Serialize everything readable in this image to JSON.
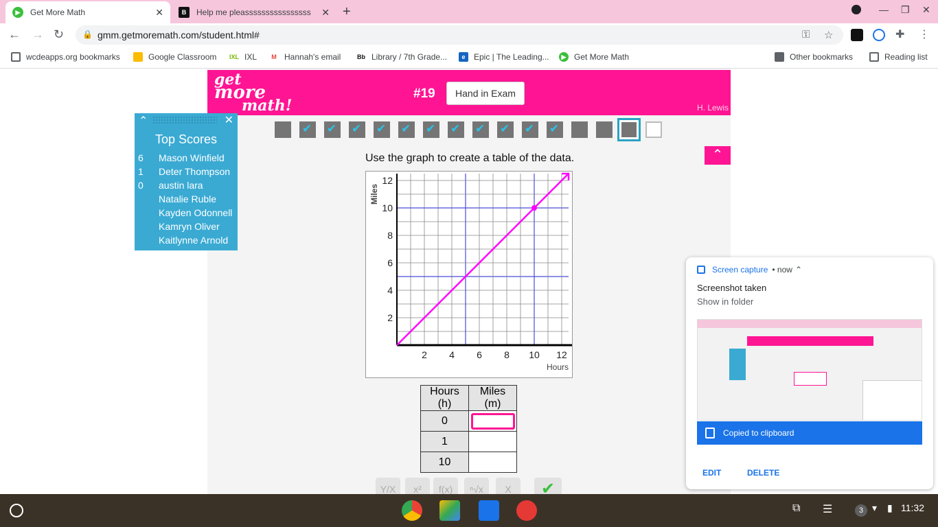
{
  "browser": {
    "tabs": [
      {
        "title": "Get More Math",
        "active": true,
        "favicon": "gmm-icon"
      },
      {
        "title": "Help me pleassssssssssssssss",
        "active": false,
        "favicon": "brainly-icon"
      }
    ],
    "url": "gmm.getmoremath.com/student.html#",
    "bookmarks": [
      {
        "label": "wcdeapps.org bookmarks"
      },
      {
        "label": "Google Classroom"
      },
      {
        "label": "IXL"
      },
      {
        "label": "Hannah's email"
      },
      {
        "label": "Library / 7th Grade..."
      },
      {
        "label": "Epic | The Leading..."
      },
      {
        "label": "Get More Math"
      }
    ],
    "other_bookmarks": "Other bookmarks",
    "reading_list": "Reading list"
  },
  "header": {
    "logo_line1": "get",
    "logo_line2": "more",
    "logo_line3": "math!",
    "question_number": "#19",
    "hand_in_label": "Hand in Exam",
    "teacher": "H. Lewis"
  },
  "progress": [
    "dark",
    "check",
    "check",
    "check",
    "check",
    "check",
    "check",
    "check",
    "check",
    "check",
    "check",
    "check",
    "dark",
    "dark",
    "current",
    "empty"
  ],
  "scores": {
    "title": "Top Scores",
    "rows": [
      {
        "score": "6",
        "name": "Mason Winfield"
      },
      {
        "score": "1",
        "name": "Deter Thompson"
      },
      {
        "score": "0",
        "name": "austin lara"
      },
      {
        "score": "",
        "name": "Natalie Ruble"
      },
      {
        "score": "",
        "name": "Kayden Odonnell"
      },
      {
        "score": "",
        "name": "Kamryn Oliver"
      },
      {
        "score": "",
        "name": "Kaitlynne Arnold"
      }
    ]
  },
  "question": {
    "prompt": "Use the graph to create a table of the data.",
    "graph": {
      "ylabel": "Miles",
      "xlabel": "Hours",
      "xticks": [
        "2",
        "4",
        "6",
        "8",
        "10",
        "12"
      ],
      "yticks": [
        "2",
        "4",
        "6",
        "8",
        "10",
        "12"
      ],
      "line_from": [
        0,
        0
      ],
      "line_to": [
        12.5,
        12.5
      ],
      "point": [
        10,
        10
      ]
    },
    "table": {
      "headers": [
        "Hours (h)",
        "Miles (m)"
      ],
      "rows": [
        {
          "hours": "0",
          "miles": ""
        },
        {
          "hours": "1",
          "miles": ""
        },
        {
          "hours": "10",
          "miles": ""
        }
      ]
    },
    "math_buttons": [
      "Y/X",
      "x²",
      "f(x)",
      "ⁿ√x",
      "X",
      "✔"
    ]
  },
  "notification": {
    "source": "Screen capture",
    "when": "• now",
    "title": "Screenshot taken",
    "subtitle": "Show in folder",
    "copied": "Copied to clipboard",
    "edit": "EDIT",
    "delete": "DELETE"
  },
  "shelf": {
    "time": "11:32",
    "notif_count": "3"
  },
  "colors": {
    "brand": "#ff1493",
    "scores_panel": "#3aaad3",
    "check": "#29c3ea"
  }
}
